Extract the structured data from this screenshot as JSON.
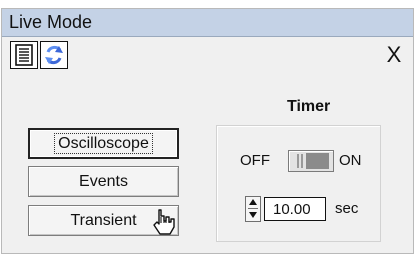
{
  "window": {
    "title": "Live Mode",
    "close_label": "X"
  },
  "toolbar": {
    "items": [
      {
        "icon": "document-icon"
      },
      {
        "icon": "refresh-icon"
      }
    ]
  },
  "modes": {
    "buttons": [
      {
        "label": "Oscilloscope",
        "active": true
      },
      {
        "label": "Events",
        "active": false
      },
      {
        "label": "Transient",
        "active": false
      }
    ]
  },
  "timer": {
    "title": "Timer",
    "off_label": "OFF",
    "on_label": "ON",
    "value": "10.00",
    "unit": "sec"
  },
  "cursor": {
    "icon": "hand-pointer-icon"
  }
}
